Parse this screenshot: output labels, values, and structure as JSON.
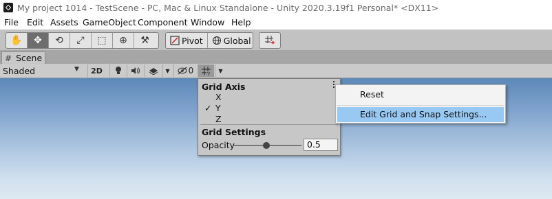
{
  "window": {
    "title": "My project 1014 - TestScene - PC, Mac & Linux Standalone - Unity 2020.3.19f1 Personal* <DX11>"
  },
  "menu": [
    "File",
    "Edit",
    "Assets",
    "GameObject",
    "Component",
    "Window",
    "Help"
  ],
  "toolbar": {
    "tools": [
      {
        "name": "hand-tool",
        "icon": "hand-icon",
        "glyph": "✋"
      },
      {
        "name": "move-tool",
        "icon": "move-arrows-icon",
        "glyph": "✥",
        "active": true
      },
      {
        "name": "rotate-tool",
        "icon": "rotate-icon",
        "glyph": "⟲"
      },
      {
        "name": "scale-tool",
        "icon": "scale-icon",
        "glyph": "⤢"
      },
      {
        "name": "rect-tool",
        "icon": "rect-icon",
        "glyph": "⬚"
      },
      {
        "name": "transform-tool",
        "icon": "transform-icon",
        "glyph": "⊕"
      },
      {
        "name": "custom-tool",
        "icon": "tools-icon",
        "glyph": "⚒"
      }
    ],
    "pivot_label": "Pivot",
    "global_label": "Global"
  },
  "scene": {
    "tab_label": "Scene",
    "shading_mode": "Shaded",
    "mode_2d": "2D",
    "hidden_count": "0"
  },
  "grid_popup": {
    "axis_heading": "Grid Axis",
    "axes": [
      "X",
      "Y",
      "Z"
    ],
    "selected_axis": "Y",
    "checkmark": "✓",
    "settings_heading": "Grid Settings",
    "opacity_label": "Opacity",
    "opacity_value": "0.5"
  },
  "context_menu": {
    "items": [
      "Reset",
      "Edit Grid and Snap Settings..."
    ],
    "hovered": "Edit Grid and Snap Settings..."
  },
  "colors": {
    "toolbar_bg": "#c2c2c2",
    "active_tool": "#6e6e6e",
    "menu_hover": "#97c9f2",
    "snap_red": "#d32f2f"
  }
}
